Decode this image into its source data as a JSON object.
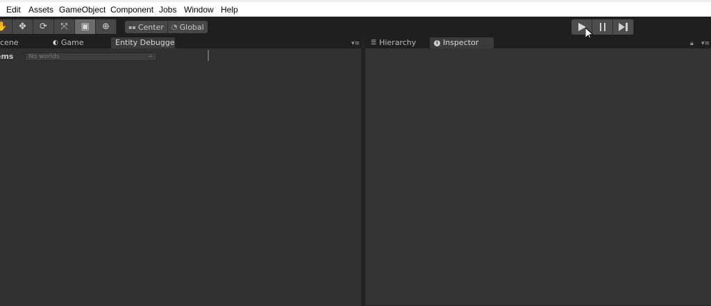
{
  "menu": {
    "items": [
      "Edit",
      "Assets",
      "GameObject",
      "Component",
      "Jobs",
      "Window",
      "Help"
    ]
  },
  "toolbar": {
    "tools": [
      {
        "icon": "hand-tool-icon",
        "glyph": "✋"
      },
      {
        "icon": "move-tool-icon",
        "glyph": "✥"
      },
      {
        "icon": "rotate-tool-icon",
        "glyph": "⟳"
      },
      {
        "icon": "scale-tool-icon",
        "glyph": "⤧"
      },
      {
        "icon": "rect-tool-icon",
        "glyph": "▣"
      },
      {
        "icon": "transform-tool-icon",
        "glyph": "⊕"
      }
    ],
    "active_tool": "rect-tool-icon",
    "pivot_label": "Center",
    "rotation_label": "Global",
    "play_icon": "play-icon",
    "pause_icon": "pause-icon",
    "step_icon": "step-icon"
  },
  "left_panel": {
    "tabs": [
      {
        "label": "Scene",
        "visible_text": "cene"
      },
      {
        "label": "Game"
      },
      {
        "label": "Entity Debugge"
      }
    ],
    "selected_tab": "Entity Debugge",
    "systems_label": "ems",
    "worlds_placeholder": "No worlds",
    "worlds_arrow": "÷"
  },
  "right_panel": {
    "tabs": [
      {
        "label": "Hierarchy"
      },
      {
        "label": "Inspector"
      }
    ],
    "selected_tab": "Inspector"
  },
  "colors": {
    "background": "#2b2b2b",
    "panel": "#303030",
    "toolbar": "#1f1f1f",
    "menubar": "#ffffff"
  }
}
